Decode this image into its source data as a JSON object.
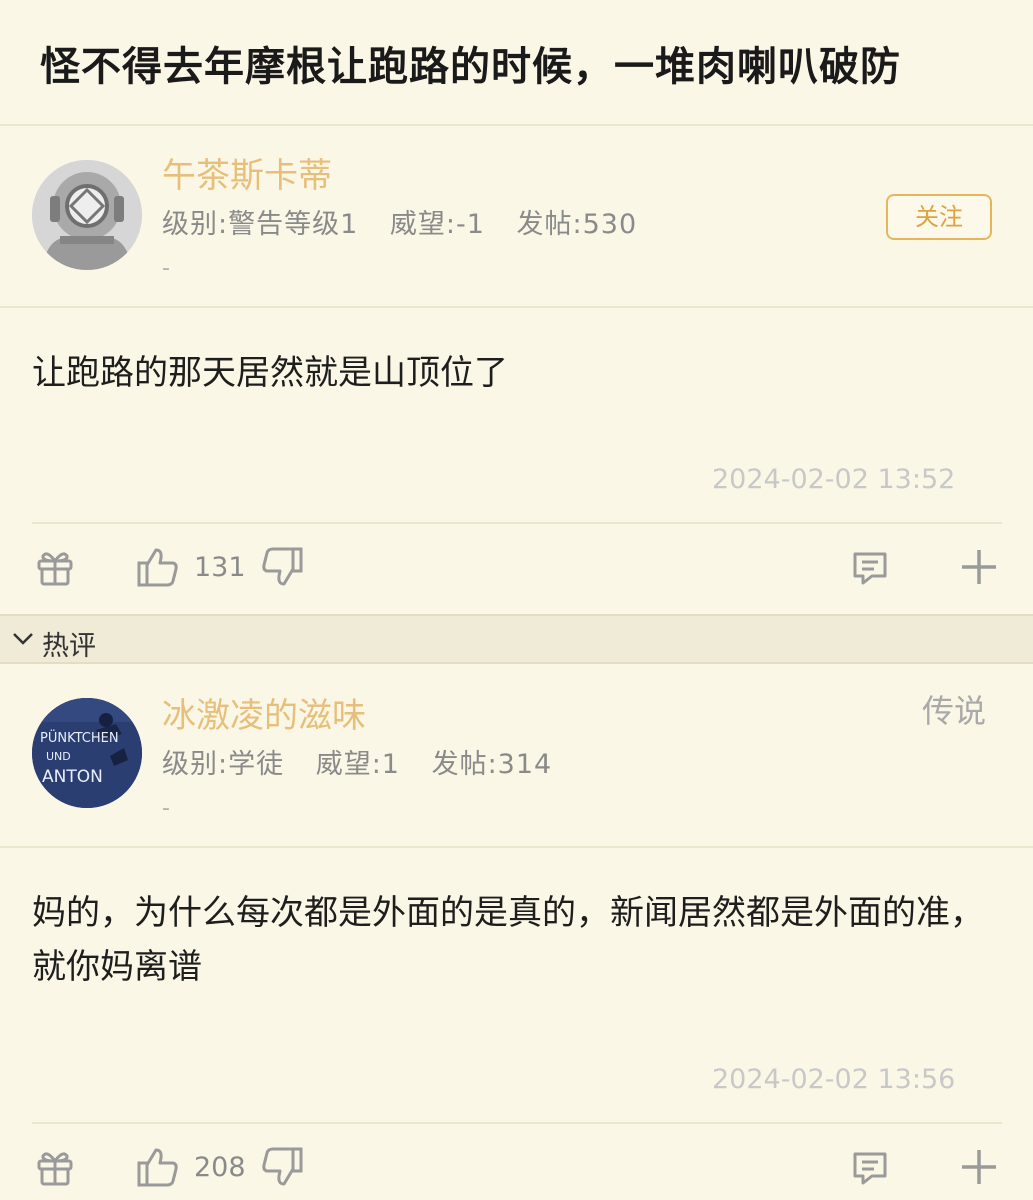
{
  "thread": {
    "title": "怪不得去年摩根让跑路的时候，一堆肉喇叭破防"
  },
  "posts": [
    {
      "username": "午茶斯卡蒂",
      "level": "级别:警告等级1",
      "prestige": "威望:-1",
      "posts": "发帖:530",
      "signature": "-",
      "follow_label": "关注",
      "content": "让跑路的那天居然就是山顶位了",
      "timestamp": "2024-02-02 13:52",
      "likes": "131",
      "avatar_icon": "diving-helmet-avatar"
    },
    {
      "username": "冰激凌的滋味",
      "rank": "传说",
      "level": "级别:学徒",
      "prestige": "威望:1",
      "posts": "发帖:314",
      "signature": "-",
      "content": "妈的，为什么每次都是外面的是真的，新闻居然都是外面的准，就你妈离谱",
      "timestamp": "2024-02-02 13:56",
      "likes": "208",
      "avatar_icon": "book-cover-avatar",
      "avatar_text": [
        "PÜNKTCHEN",
        "UND",
        "ANTON"
      ]
    }
  ],
  "hot_section": {
    "label": "热评",
    "icon": "chevron-down-icon"
  },
  "action_icons": [
    "gift-icon",
    "thumbs-up-icon",
    "thumbs-down-icon",
    "comment-icon",
    "plus-icon"
  ],
  "colors": {
    "background": "#fbf7e6",
    "username": "#e6bf7a",
    "follow_border": "#e6b65c",
    "section_bar": "#efebd6"
  }
}
